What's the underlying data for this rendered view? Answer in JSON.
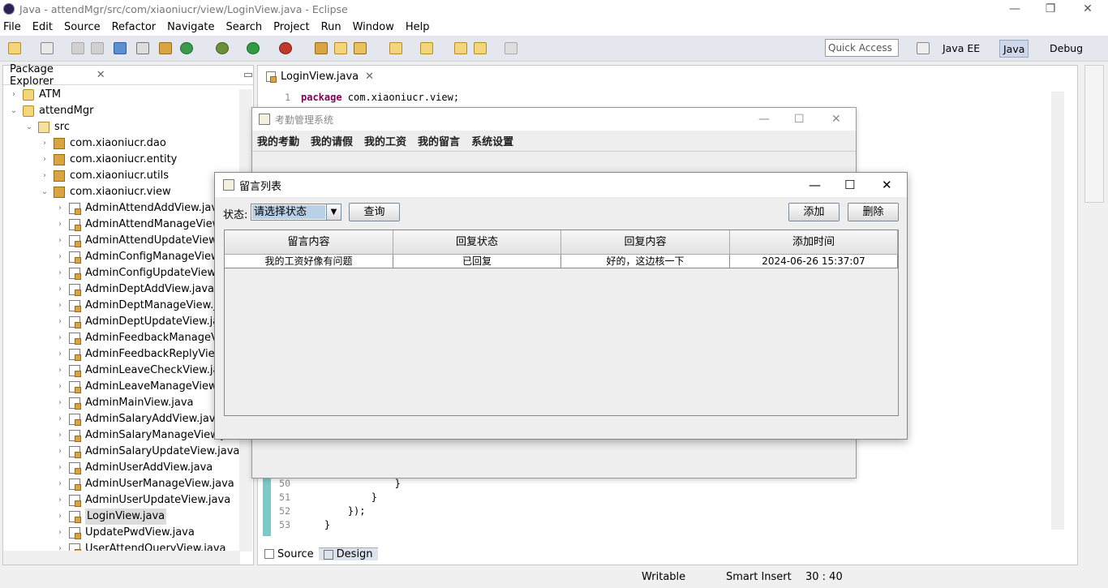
{
  "window": {
    "title": "Java - attendMgr/src/com/xiaoniucr/view/LoginView.java - Eclipse",
    "minimize": "—",
    "maximize": "❐",
    "close": "✕"
  },
  "menu": [
    "File",
    "Edit",
    "Source",
    "Refactor",
    "Navigate",
    "Search",
    "Project",
    "Run",
    "Window",
    "Help"
  ],
  "toolbar": {
    "quick_access": "Quick Access",
    "perspectives": [
      "Java EE",
      "Java",
      "Debug"
    ]
  },
  "package_explorer": {
    "title": "Package Explorer",
    "items": [
      {
        "label": "ATM",
        "level": 0,
        "icon": "project",
        "expanded": false
      },
      {
        "label": "attendMgr",
        "level": 0,
        "icon": "project",
        "expanded": true
      },
      {
        "label": "src",
        "level": 1,
        "icon": "source-folder",
        "expanded": true
      },
      {
        "label": "com.xiaoniucr.dao",
        "level": 2,
        "icon": "package",
        "expanded": false
      },
      {
        "label": "com.xiaoniucr.entity",
        "level": 2,
        "icon": "package",
        "expanded": false
      },
      {
        "label": "com.xiaoniucr.utils",
        "level": 2,
        "icon": "package",
        "expanded": false
      },
      {
        "label": "com.xiaoniucr.view",
        "level": 2,
        "icon": "package",
        "expanded": true
      },
      {
        "label": "AdminAttendAddView.java",
        "level": 3,
        "icon": "java"
      },
      {
        "label": "AdminAttendManageView.ja",
        "level": 3,
        "icon": "java"
      },
      {
        "label": "AdminAttendUpdateView.ja",
        "level": 3,
        "icon": "java"
      },
      {
        "label": "AdminConfigManageView.ja",
        "level": 3,
        "icon": "java"
      },
      {
        "label": "AdminConfigUpdateView.ja",
        "level": 3,
        "icon": "java"
      },
      {
        "label": "AdminDeptAddView.java",
        "level": 3,
        "icon": "java"
      },
      {
        "label": "AdminDeptManageView.jav",
        "level": 3,
        "icon": "java"
      },
      {
        "label": "AdminDeptUpdateView.java",
        "level": 3,
        "icon": "java"
      },
      {
        "label": "AdminFeedbackManageVie",
        "level": 3,
        "icon": "java"
      },
      {
        "label": "AdminFeedbackReplyView.j",
        "level": 3,
        "icon": "java"
      },
      {
        "label": "AdminLeaveCheckView.java",
        "level": 3,
        "icon": "java"
      },
      {
        "label": "AdminLeaveManageView.ja",
        "level": 3,
        "icon": "java"
      },
      {
        "label": "AdminMainView.java",
        "level": 3,
        "icon": "java"
      },
      {
        "label": "AdminSalaryAddView.java",
        "level": 3,
        "icon": "java"
      },
      {
        "label": "AdminSalaryManageView.ja",
        "level": 3,
        "icon": "java"
      },
      {
        "label": "AdminSalaryUpdateView.java",
        "level": 3,
        "icon": "java"
      },
      {
        "label": "AdminUserAddView.java",
        "level": 3,
        "icon": "java"
      },
      {
        "label": "AdminUserManageView.java",
        "level": 3,
        "icon": "java"
      },
      {
        "label": "AdminUserUpdateView.java",
        "level": 3,
        "icon": "java"
      },
      {
        "label": "LoginView.java",
        "level": 3,
        "icon": "java",
        "selected": true
      },
      {
        "label": "UpdatePwdView.java",
        "level": 3,
        "icon": "java"
      },
      {
        "label": "UserAttendQueryView.java",
        "level": 3,
        "icon": "java"
      }
    ]
  },
  "editor": {
    "tab": "LoginView.java",
    "line1": {
      "num": "1",
      "keyword": "package",
      "rest": " com.xiaoniucr.view;"
    },
    "tail_lines": [
      {
        "num": "50",
        "text": "                }"
      },
      {
        "num": "51",
        "text": "            }"
      },
      {
        "num": "52",
        "text": "        });"
      },
      {
        "num": "53",
        "text": "    }"
      }
    ],
    "bottom_tabs": [
      "Source",
      "Design"
    ]
  },
  "status": {
    "writable": "Writable",
    "insert_mode": "Smart Insert",
    "position": "30 : 40"
  },
  "app_window": {
    "title": "考勤管理系统",
    "menu": [
      "我的考勤",
      "我的请假",
      "我的工资",
      "我的留言",
      "系统设置"
    ]
  },
  "dialog": {
    "title": "留言列表",
    "status_label": "状态:",
    "status_value": "请选择状态",
    "query_button": "查询",
    "add_button": "添加",
    "delete_button": "删除",
    "columns": [
      "留言内容",
      "回复状态",
      "回复内容",
      "添加时间"
    ],
    "rows": [
      [
        "我的工资好像有问题",
        "已回复",
        "好的，这边核一下",
        "2024-06-26 15:37:07"
      ]
    ]
  }
}
